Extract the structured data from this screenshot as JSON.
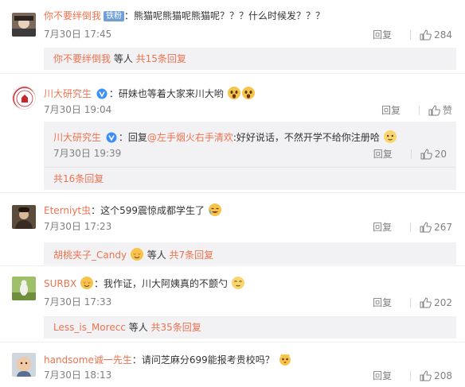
{
  "comments": [
    {
      "user": "你不要绊倒我",
      "badge": "铁粉",
      "text": "：熊猫呢熊猫呢熊猫呢？？？什么时候发？？？",
      "time": "7月30日 17:45",
      "reply_label": "回复",
      "likes": "284",
      "summary": {
        "users": "你不要绊倒我",
        "mid": " 等人 ",
        "link": "共15条回复"
      }
    },
    {
      "user": "川大研究生",
      "text": "：研妹也等着大家来川大哟",
      "time": "7月30日 19:04",
      "reply_label": "回复",
      "likes": "赞",
      "sub": {
        "user": "川大研究生",
        "prefix": "：回复",
        "at": "@左手烟火右手清欢",
        "text": ":好好说话，不然开学不给你注册哈",
        "time": "7月30日 19:39",
        "reply_label": "回复",
        "likes": "20"
      },
      "summary": {
        "link": "共16条回复"
      }
    },
    {
      "user": "Eterniyt虫",
      "text": "：这个599震惊成都学生了",
      "time": "7月30日 17:23",
      "reply_label": "回复",
      "likes": "267",
      "summary": {
        "users": "胡桃夹子_Candy",
        "mid": " 等人 ",
        "link": "共7条回复"
      }
    },
    {
      "user": "SURBX",
      "text": "：我作证，川大阿姨真的不颤勺",
      "time": "7月30日 17:33",
      "reply_label": "回复",
      "likes": "202",
      "summary": {
        "users": "Less_is_Morecc",
        "mid": " 等人 ",
        "link": "共35条回复"
      }
    },
    {
      "user": "handsome诚一先生",
      "text": "：请问芝麻分699能报考贵校吗？",
      "time": "7月30日 18:13",
      "reply_label": "回复",
      "likes": "208"
    }
  ],
  "colors": {
    "accent": "#eb7350",
    "meta": "#808080",
    "box_bg": "#f2f2f5",
    "verified": "#3c8ff5"
  },
  "icons": {
    "like": "thumbs-up-icon",
    "verified": "verified-v-icon",
    "emoji": "emoji-icon"
  }
}
